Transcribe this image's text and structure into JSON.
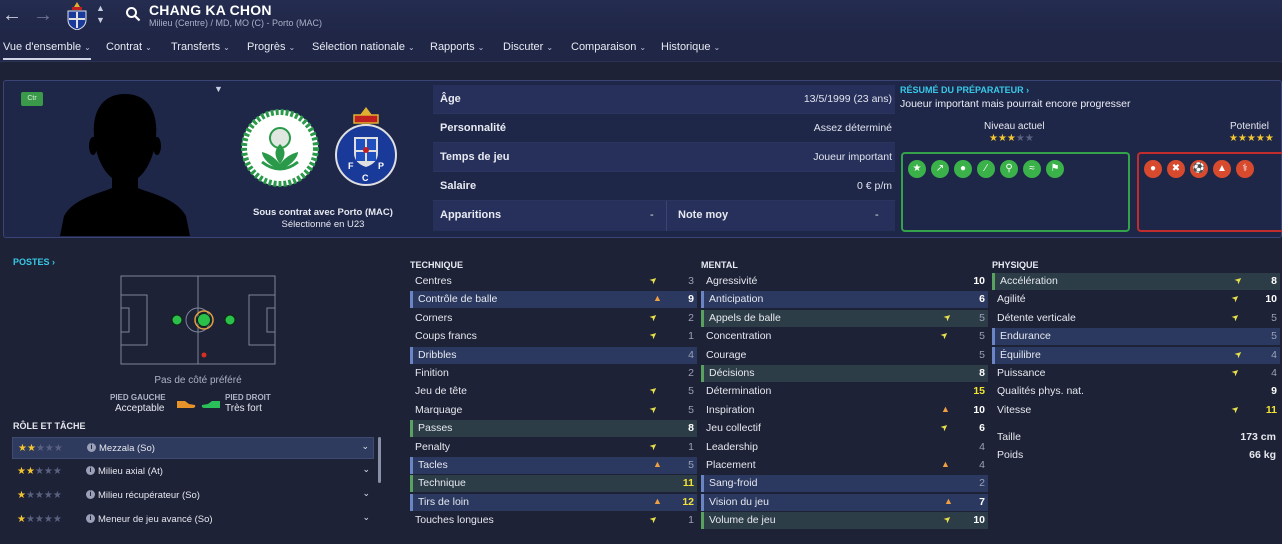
{
  "header": {
    "player_name": "CHANG KA CHON",
    "player_subtitle": "Milieu (Centre) / MD, MO (C) - Porto (MAC)"
  },
  "menu": [
    {
      "label": "Vue d'ensemble"
    },
    {
      "label": "Contrat"
    },
    {
      "label": "Transferts"
    },
    {
      "label": "Progrès"
    },
    {
      "label": "Sélection nationale"
    },
    {
      "label": "Rapports"
    },
    {
      "label": "Discuter"
    },
    {
      "label": "Comparaison"
    },
    {
      "label": "Historique"
    }
  ],
  "profile": {
    "badge": "Ctr",
    "contract_line1": "Sous contrat avec Porto (MAC)",
    "contract_line2": "Sélectionné en U23"
  },
  "info": {
    "age_k": "Âge",
    "age_v": "13/5/1999 (23 ans)",
    "pers_k": "Personnalité",
    "pers_v": "Assez déterminé",
    "time_k": "Temps de jeu",
    "time_v": "Joueur important",
    "sal_k": "Salaire",
    "sal_v": "0 € p/m",
    "apps_k": "Apparitions",
    "apps_v": "-",
    "note_k": "Note moy",
    "note_v": "-"
  },
  "summary": {
    "title": "RÉSUMÉ DU PRÉPARATEUR ›",
    "text": "Joueur important mais pourrait encore progresser",
    "current_label": "Niveau actuel",
    "current_stars": 2.5,
    "potential_label": "Potentiel",
    "potential_stars": 5
  },
  "positions": {
    "title": "POSTES ›",
    "pref_side": "Pas de côté préféré",
    "left_foot_label": "PIED GAUCHE",
    "left_foot_value": "Acceptable",
    "right_foot_label": "PIED DROIT",
    "right_foot_value": "Très fort"
  },
  "roles": {
    "title": "RÔLE ET TÂCHE",
    "items": [
      {
        "name": "Mezzala (So)",
        "stars": 1.5
      },
      {
        "name": "Milieu axial (At)",
        "stars": 1.5
      },
      {
        "name": "Milieu récupérateur (So)",
        "stars": 1
      },
      {
        "name": "Meneur de jeu avancé (So)",
        "stars": 1
      }
    ]
  },
  "technique": {
    "title": "TECHNIQUE",
    "rows": [
      {
        "name": "Centres",
        "arrow": "dn",
        "value": "3"
      },
      {
        "name": "Contrôle de balle",
        "arrow": "up",
        "value": "9"
      },
      {
        "name": "Corners",
        "arrow": "dn",
        "value": "2"
      },
      {
        "name": "Coups francs",
        "arrow": "dn",
        "value": "1"
      },
      {
        "name": "Dribbles",
        "arrow": "",
        "value": "4"
      },
      {
        "name": "Finition",
        "arrow": "",
        "value": "2"
      },
      {
        "name": "Jeu de tête",
        "arrow": "dn",
        "value": "5"
      },
      {
        "name": "Marquage",
        "arrow": "dn",
        "value": "5"
      },
      {
        "name": "Passes",
        "arrow": "",
        "value": "8"
      },
      {
        "name": "Penalty",
        "arrow": "dn",
        "value": "1"
      },
      {
        "name": "Tacles",
        "arrow": "up",
        "value": "5"
      },
      {
        "name": "Technique",
        "arrow": "",
        "value": "11"
      },
      {
        "name": "Tirs de loin",
        "arrow": "up",
        "value": "12"
      },
      {
        "name": "Touches longues",
        "arrow": "dn",
        "value": "1"
      }
    ]
  },
  "mental": {
    "title": "MENTAL",
    "rows": [
      {
        "name": "Agressivité",
        "arrow": "",
        "value": "10"
      },
      {
        "name": "Anticipation",
        "arrow": "",
        "value": "6"
      },
      {
        "name": "Appels de balle",
        "arrow": "dn",
        "value": "5"
      },
      {
        "name": "Concentration",
        "arrow": "dn",
        "value": "5"
      },
      {
        "name": "Courage",
        "arrow": "",
        "value": "5"
      },
      {
        "name": "Décisions",
        "arrow": "",
        "value": "8"
      },
      {
        "name": "Détermination",
        "arrow": "",
        "value": "15"
      },
      {
        "name": "Inspiration",
        "arrow": "up",
        "value": "10"
      },
      {
        "name": "Jeu collectif",
        "arrow": "dn",
        "value": "6"
      },
      {
        "name": "Leadership",
        "arrow": "",
        "value": "4"
      },
      {
        "name": "Placement",
        "arrow": "up",
        "value": "4"
      },
      {
        "name": "Sang-froid",
        "arrow": "",
        "value": "2"
      },
      {
        "name": "Vision du jeu",
        "arrow": "up",
        "value": "7"
      },
      {
        "name": "Volume de jeu",
        "arrow": "dn",
        "value": "10"
      }
    ]
  },
  "physique": {
    "title": "PHYSIQUE",
    "rows": [
      {
        "name": "Accélération",
        "arrow": "dn",
        "value": "8"
      },
      {
        "name": "Agilité",
        "arrow": "dn",
        "value": "10"
      },
      {
        "name": "Détente verticale",
        "arrow": "dn",
        "value": "5"
      },
      {
        "name": "Endurance",
        "arrow": "",
        "value": "5"
      },
      {
        "name": "Équilibre",
        "arrow": "dn",
        "value": "4"
      },
      {
        "name": "Puissance",
        "arrow": "dn",
        "value": "4"
      },
      {
        "name": "Qualités phys. nat.",
        "arrow": "",
        "value": "9"
      },
      {
        "name": "Vitesse",
        "arrow": "dn",
        "value": "11"
      }
    ],
    "height_label": "Taille",
    "height_value": "173 cm",
    "weight_label": "Poids",
    "weight_value": "66 kg"
  },
  "colors": {
    "accent": "#38c9e8",
    "positive_box": "#33a24a",
    "negative_box": "#c12c2c",
    "star": "#f2c531"
  }
}
